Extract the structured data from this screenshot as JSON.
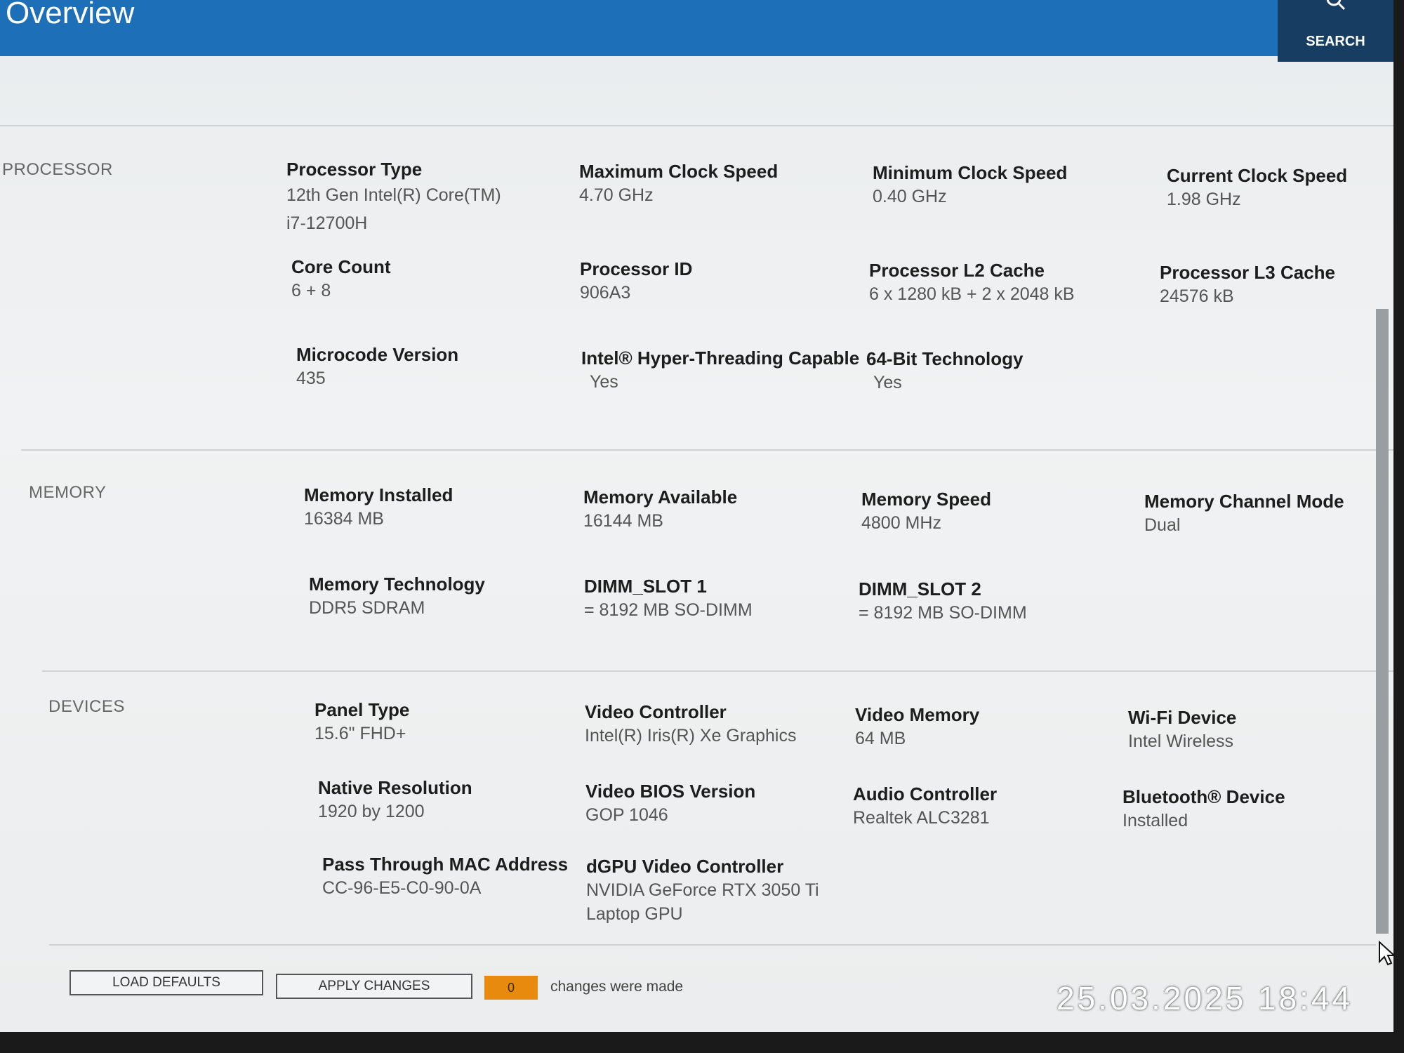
{
  "header": {
    "title": "Overview",
    "search_label": "SEARCH"
  },
  "sections": [
    {
      "label": "PROCESSOR",
      "fields": [
        {
          "name": "Processor Type",
          "value": "12th Gen Intel(R) Core(TM) i7-12700H"
        },
        {
          "name": "Maximum Clock Speed",
          "value": "4.70 GHz"
        },
        {
          "name": "Minimum Clock Speed",
          "value": "0.40 GHz"
        },
        {
          "name": "Current Clock Speed",
          "value": "1.98 GHz"
        },
        {
          "name": "Core Count",
          "value": "6 + 8"
        },
        {
          "name": "Processor ID",
          "value": "906A3"
        },
        {
          "name": "Processor L2 Cache",
          "value": "6 x 1280  kB + 2 x 2048  kB"
        },
        {
          "name": "Processor L3 Cache",
          "value": "24576 kB"
        },
        {
          "name": "Microcode Version",
          "value": "435"
        },
        {
          "name": "Intel® Hyper-Threading Capable",
          "value": "Yes"
        },
        {
          "name": "64-Bit Technology",
          "value": "Yes"
        }
      ]
    },
    {
      "label": "MEMORY",
      "fields": [
        {
          "name": "Memory Installed",
          "value": "16384 MB"
        },
        {
          "name": "Memory Available",
          "value": "16144 MB"
        },
        {
          "name": "Memory Speed",
          "value": "4800 MHz"
        },
        {
          "name": "Memory Channel Mode",
          "value": "Dual"
        },
        {
          "name": "Memory Technology",
          "value": "DDR5 SDRAM"
        },
        {
          "name": "DIMM_SLOT 1",
          "value": "= 8192 MB SO-DIMM"
        },
        {
          "name": "DIMM_SLOT 2",
          "value": "= 8192 MB SO-DIMM"
        }
      ]
    },
    {
      "label": "DEVICES",
      "fields": [
        {
          "name": "Panel Type",
          "value": "15.6\" FHD+"
        },
        {
          "name": "Video Controller",
          "value": "Intel(R) Iris(R) Xe Graphics"
        },
        {
          "name": "Video Memory",
          "value": "64 MB"
        },
        {
          "name": "Wi-Fi Device",
          "value": "Intel Wireless"
        },
        {
          "name": "Native Resolution",
          "value": "1920 by 1200"
        },
        {
          "name": "Video BIOS Version",
          "value": "GOP 1046"
        },
        {
          "name": "Audio Controller",
          "value": "Realtek ALC3281"
        },
        {
          "name": "Bluetooth® Device",
          "value": "Installed"
        },
        {
          "name": "Pass Through MAC Address",
          "value": "CC-96-E5-C0-90-0A"
        },
        {
          "name": "dGPU Video Controller",
          "value": "NVIDIA GeForce RTX 3050 Ti Laptop GPU"
        }
      ]
    }
  ],
  "footer": {
    "load_defaults": "LOAD DEFAULTS",
    "apply_changes": "APPLY CHANGES",
    "change_count": "0",
    "changes_text": "changes were made"
  },
  "timestamp": "25.03.2025 18:44"
}
